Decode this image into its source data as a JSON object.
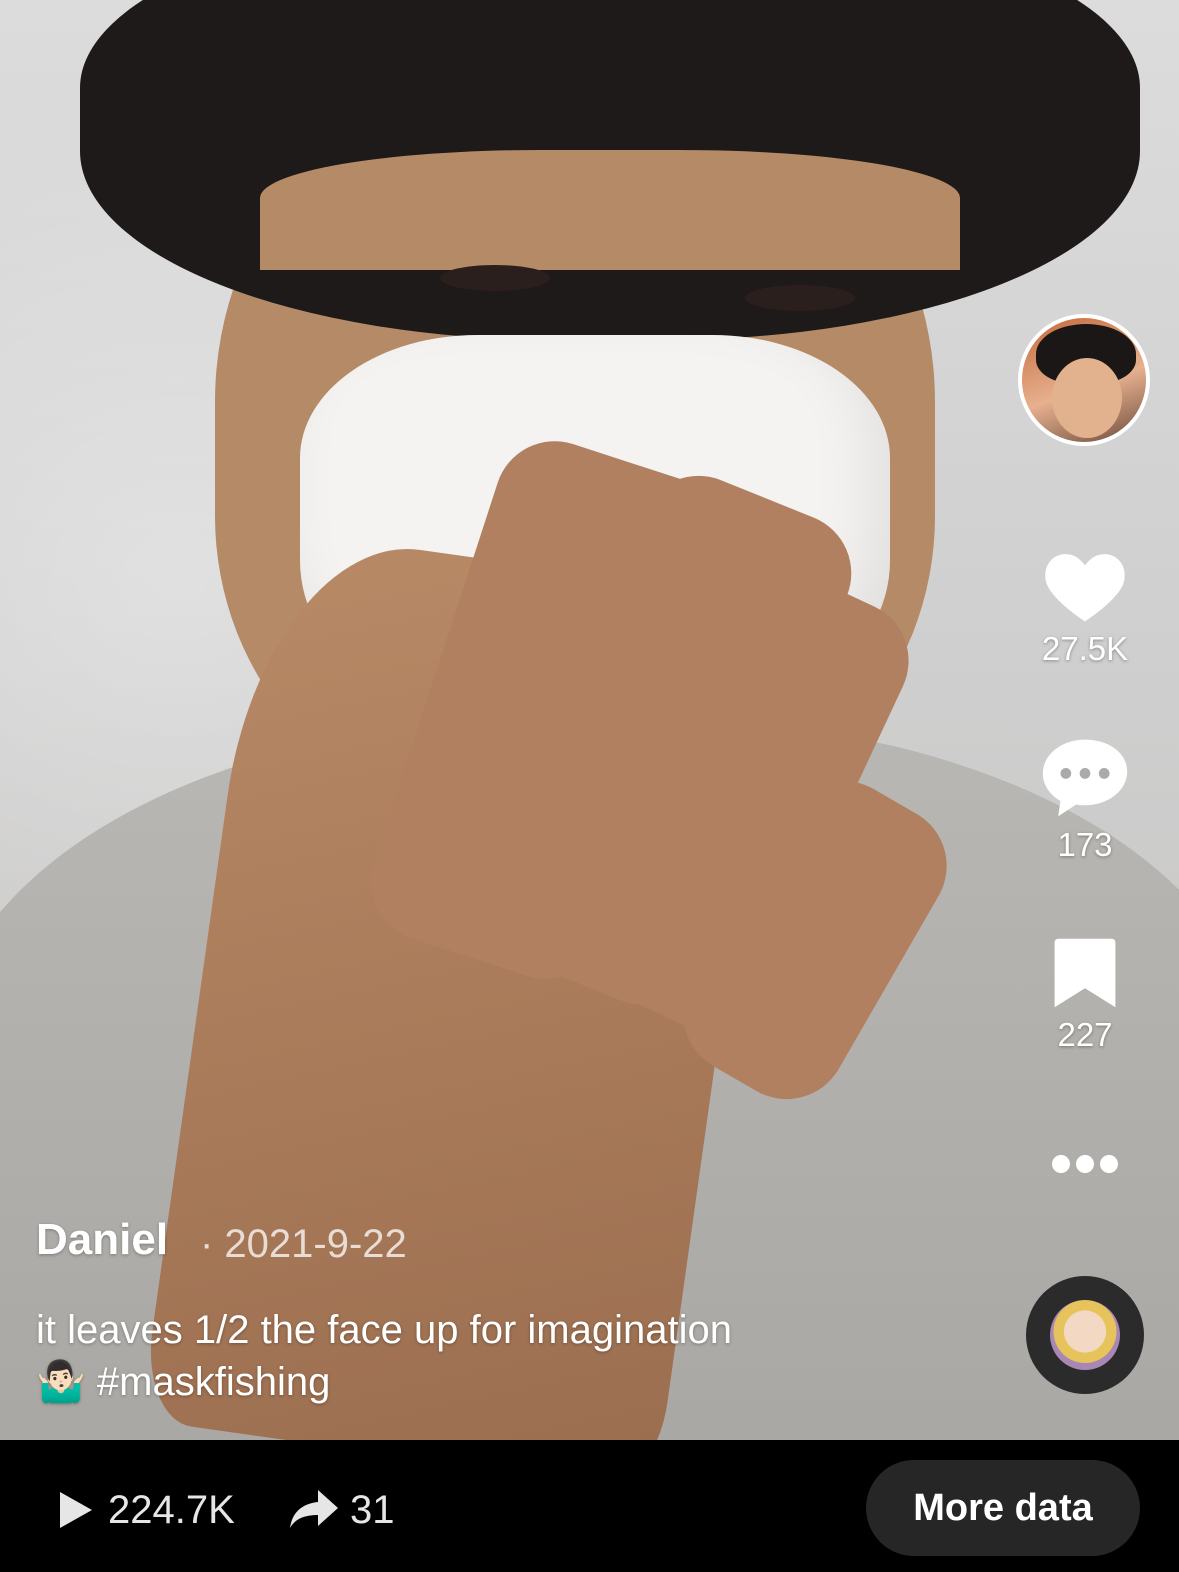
{
  "post": {
    "author": "Daniel",
    "date": "· 2021-9-22",
    "caption_line1": "it leaves 1/2 the face up for imagination",
    "caption_line2": "🤷🏻‍♂️ #maskfishing"
  },
  "actions": {
    "likes": "27.5K",
    "comments": "173",
    "saves": "227"
  },
  "stats": {
    "plays": "224.7K",
    "shares": "31"
  },
  "buttons": {
    "more_data": "More data"
  },
  "icons": {
    "like": "heart-icon",
    "comment": "comment-bubble-icon",
    "save": "bookmark-icon",
    "more": "more-dots-icon",
    "plays": "play-icon",
    "shares": "share-arrow-icon"
  }
}
